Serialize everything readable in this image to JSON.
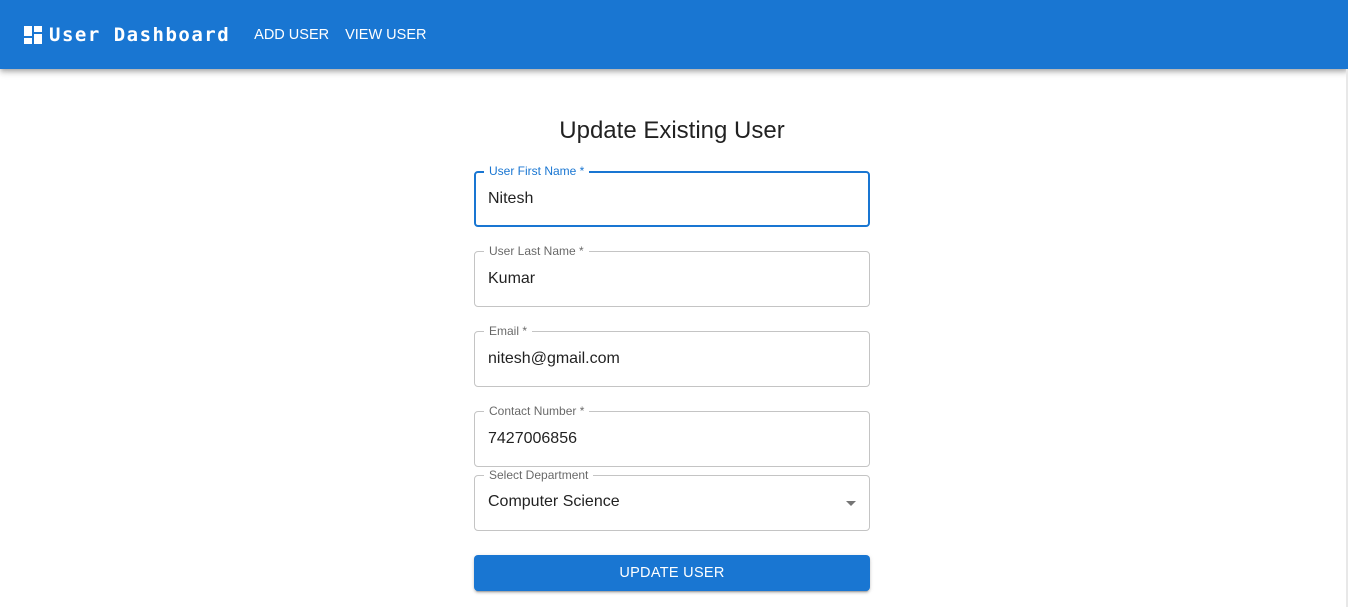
{
  "appbar": {
    "title": "User Dashboard",
    "icon": "dashboard-icon",
    "nav": [
      {
        "label": "ADD USER"
      },
      {
        "label": "VIEW USER"
      }
    ],
    "color": "#1976d2"
  },
  "form": {
    "title": "Update Existing User",
    "fields": {
      "first_name": {
        "label": "User First Name *",
        "value": "Nitesh"
      },
      "last_name": {
        "label": "User Last Name *",
        "value": "Kumar"
      },
      "email": {
        "label": "Email *",
        "value": "nitesh@gmail.com"
      },
      "contact": {
        "label": "Contact Number *",
        "value": "7427006856"
      },
      "department": {
        "label": "Select Department",
        "value": "Computer Science"
      }
    },
    "submit_label": "UPDATE USER"
  }
}
